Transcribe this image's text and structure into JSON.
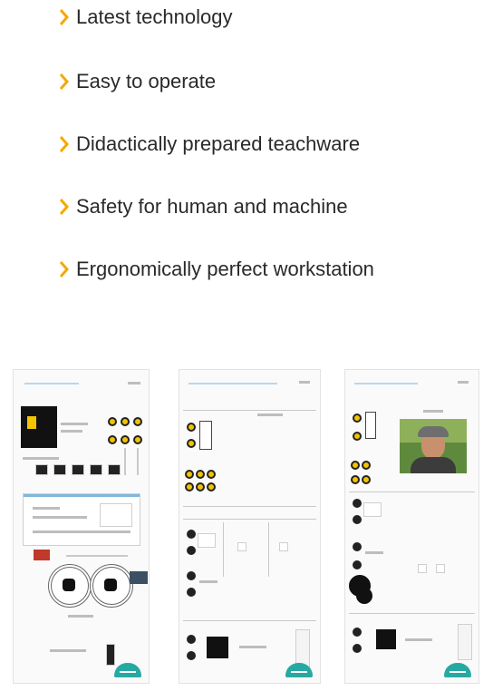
{
  "features": [
    {
      "text": "Latest technology"
    },
    {
      "text": "Easy to operate"
    },
    {
      "text": "Didactically prepared teachware"
    },
    {
      "text": "Safety for human and machine"
    },
    {
      "text": "Ergonomically perfect workstation"
    }
  ],
  "colors": {
    "accent": "#f5a800",
    "text": "#2a2a2a",
    "panel_bg": "#fafafa",
    "node_yellow": "#f2c400",
    "logo": "#27a9a3"
  },
  "icons": {
    "bullet": "chevron-right-icon",
    "brand": "logo-icon",
    "photo": "person-photo",
    "tablet": "tablet-icon"
  }
}
